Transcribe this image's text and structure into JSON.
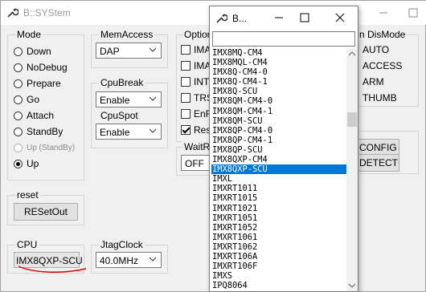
{
  "window": {
    "title": "B::SYStem"
  },
  "popup": {
    "title": "B...",
    "filter_value": "",
    "items": [
      "IMX8MQ-CM4",
      "IMX8MQL-CM4",
      "IMX8Q-CM4-0",
      "IMX8Q-CM4-1",
      "IMX8Q-SCU",
      "IMX8QM-CM4-0",
      "IMX8QM-CM4-1",
      "IMX8QM-SCU",
      "IMX8QP-CM4-0",
      "IMX8QP-CM4-1",
      "IMX8QP-SCU",
      "IMX8QXP-CM4",
      "IMX8QXP-SCU",
      "IMXL",
      "IMXRT1011",
      "IMXRT1015",
      "IMXRT1021",
      "IMXRT1051",
      "IMXRT1052",
      "IMXRT1061",
      "IMXRT1062",
      "IMXRT106A",
      "IMXRT106F",
      "IMXS",
      "IPQ8064"
    ],
    "selected_index": 12
  },
  "mode": {
    "label": "Mode",
    "options": [
      "Down",
      "NoDebug",
      "Prepare",
      "Go",
      "Attach",
      "StandBy",
      "Up (StandBy)",
      "Up"
    ],
    "selected": "Up",
    "disabled": [
      "Up (StandBy)"
    ]
  },
  "memaccess": {
    "label": "MemAccess",
    "value": "DAP"
  },
  "cpubreak": {
    "label": "CpuBreak",
    "value": "Enable"
  },
  "cpuspot": {
    "label": "CpuSpot",
    "value": "Enable"
  },
  "option": {
    "label": "Option",
    "checkboxes": [
      {
        "text": "IMAS",
        "checked": false
      },
      {
        "text": "IMAS",
        "checked": false
      },
      {
        "text": "INTD",
        "checked": false
      },
      {
        "text": "TRS",
        "checked": false
      },
      {
        "text": "EnRe",
        "checked": false
      },
      {
        "text": "ResB",
        "checked": true
      }
    ]
  },
  "waitreset": {
    "label": "WaitRe",
    "value": "OFF"
  },
  "dismode": {
    "label": "n DisMode",
    "options": [
      "AUTO",
      "ACCESS",
      "ARM",
      "THUMB"
    ]
  },
  "buttons": {
    "config": "CONFIG",
    "detect": "DETECT",
    "reset": "RESetOut"
  },
  "reset_group": {
    "label": "reset"
  },
  "cpu": {
    "label": "CPU",
    "value": "IMX8QXP-SCU"
  },
  "jtagclock": {
    "label": "JtagClock",
    "value": "40.0MHz"
  },
  "colors": {
    "selection": "#0078d7",
    "annotation": "#e00000"
  }
}
